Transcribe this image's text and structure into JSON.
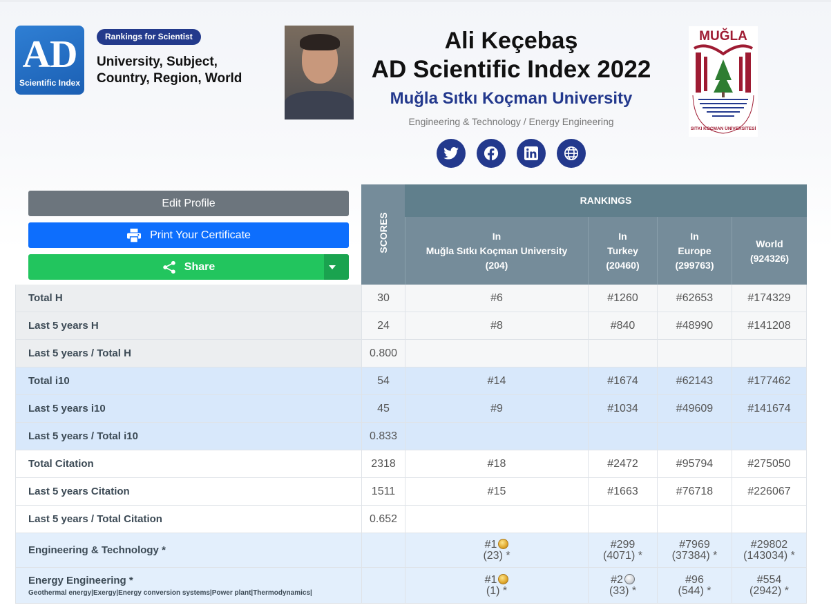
{
  "brand": {
    "logo_big": "AD",
    "logo_small": "Scientific Index",
    "badge": "Rankings for Scientist",
    "tagline": "University, Subject, Country, Region, World"
  },
  "profile": {
    "name": "Ali Keçebaş",
    "index_title": "AD Scientific Index 2022",
    "university": "Muğla Sıtkı Koçman University",
    "subject": "Engineering & Technology / Energy Engineering",
    "uni_logo_text": "MUĞLA",
    "uni_logo_ring": "SITKI KOÇMAN ÜNİVERSİTESİ"
  },
  "social_icons": [
    "twitter-icon",
    "facebook-icon",
    "linkedin-icon",
    "globe-icon"
  ],
  "buttons": {
    "edit": "Edit Profile",
    "print": "Print Your Certificate",
    "share": "Share"
  },
  "table_header": {
    "scores": "SCORES",
    "rankings": "RANKINGS",
    "columns": [
      {
        "l1": "In",
        "l2": "Muğla Sıtkı Koçman University",
        "l3": "(204)"
      },
      {
        "l1": "In",
        "l2": "Turkey",
        "l3": "(20460)"
      },
      {
        "l1": "In",
        "l2": "Europe",
        "l3": "(299763)"
      },
      {
        "l1": "World",
        "l2": "(924326)",
        "l3": ""
      }
    ]
  },
  "rows": [
    {
      "label": "Total H",
      "score": "30",
      "r": [
        "#6",
        "#1260",
        "#62653",
        "#174329"
      ]
    },
    {
      "label": "Last 5 years H",
      "score": "24",
      "r": [
        "#8",
        "#840",
        "#48990",
        "#141208"
      ]
    },
    {
      "label": "Last 5 years / Total H",
      "score": "0.800",
      "r": [
        "",
        "",
        "",
        ""
      ]
    },
    {
      "label": "Total i10",
      "score": "54",
      "r": [
        "#14",
        "#1674",
        "#62143",
        "#177462"
      ]
    },
    {
      "label": "Last 5 years i10",
      "score": "45",
      "r": [
        "#9",
        "#1034",
        "#49609",
        "#141674"
      ]
    },
    {
      "label": "Last 5 years / Total i10",
      "score": "0.833",
      "r": [
        "",
        "",
        "",
        ""
      ]
    },
    {
      "label": "Total Citation",
      "score": "2318",
      "r": [
        "#18",
        "#2472",
        "#95794",
        "#275050"
      ]
    },
    {
      "label": "Last 5 years Citation",
      "score": "1511",
      "r": [
        "#15",
        "#1663",
        "#76718",
        "#226067"
      ]
    },
    {
      "label": "Last 5 years / Total Citation",
      "score": "0.652",
      "r": [
        "",
        "",
        "",
        ""
      ]
    }
  ],
  "subject_rows": [
    {
      "label": "Engineering & Technology *",
      "sub": "",
      "r": [
        {
          "rank": "#1",
          "total": "(23) *",
          "medal": "gold"
        },
        {
          "rank": "#299",
          "total": "(4071) *",
          "medal": ""
        },
        {
          "rank": "#7969",
          "total": "(37384) *",
          "medal": ""
        },
        {
          "rank": "#29802",
          "total": "(143034) *",
          "medal": ""
        }
      ]
    },
    {
      "label": "Energy Engineering *",
      "sub": "Geothermal energy|Exergy|Energy conversion systems|Power plant|Thermodynamics|",
      "r": [
        {
          "rank": "#1",
          "total": "(1) *",
          "medal": "gold"
        },
        {
          "rank": "#2",
          "total": "(33) *",
          "medal": "silver"
        },
        {
          "rank": "#96",
          "total": "(544) *",
          "medal": ""
        },
        {
          "rank": "#554",
          "total": "(2942) *",
          "medal": ""
        }
      ]
    }
  ],
  "colors": {
    "brand_blue": "#23398d",
    "print_blue": "#0d6efd",
    "share_green": "#22c55e",
    "edit_gray": "#6c757d",
    "header_slate": "#758c9a"
  }
}
